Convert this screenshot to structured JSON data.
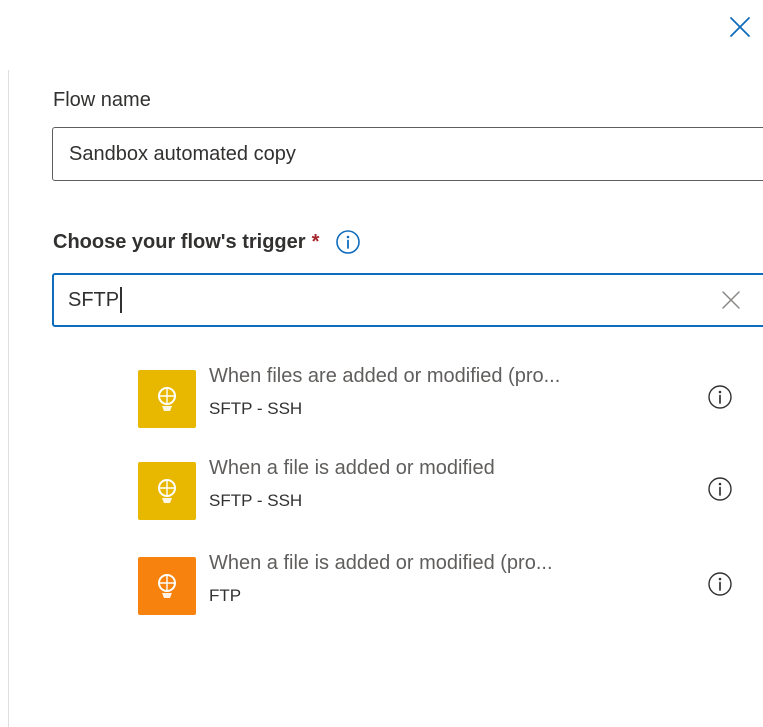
{
  "form": {
    "flow_name_label": "Flow name",
    "flow_name_value": "Sandbox automated copy",
    "trigger_label": "Choose your flow's trigger",
    "required_marker": "*",
    "search_value": "SFTP"
  },
  "results": [
    {
      "title": "When files are added or modified (pro...",
      "connector": "SFTP - SSH",
      "icon": "sftp-ssh-connector-icon",
      "color": "#e8b800"
    },
    {
      "title": "When a file is added or modified",
      "connector": "SFTP - SSH",
      "icon": "sftp-ssh-connector-icon",
      "color": "#e8b800"
    },
    {
      "title": "When a file is added or modified (pro...",
      "connector": "FTP",
      "icon": "ftp-connector-icon",
      "color": "#f7820e"
    }
  ],
  "colors": {
    "accent": "#0f6cbd",
    "required": "#a4262c"
  }
}
